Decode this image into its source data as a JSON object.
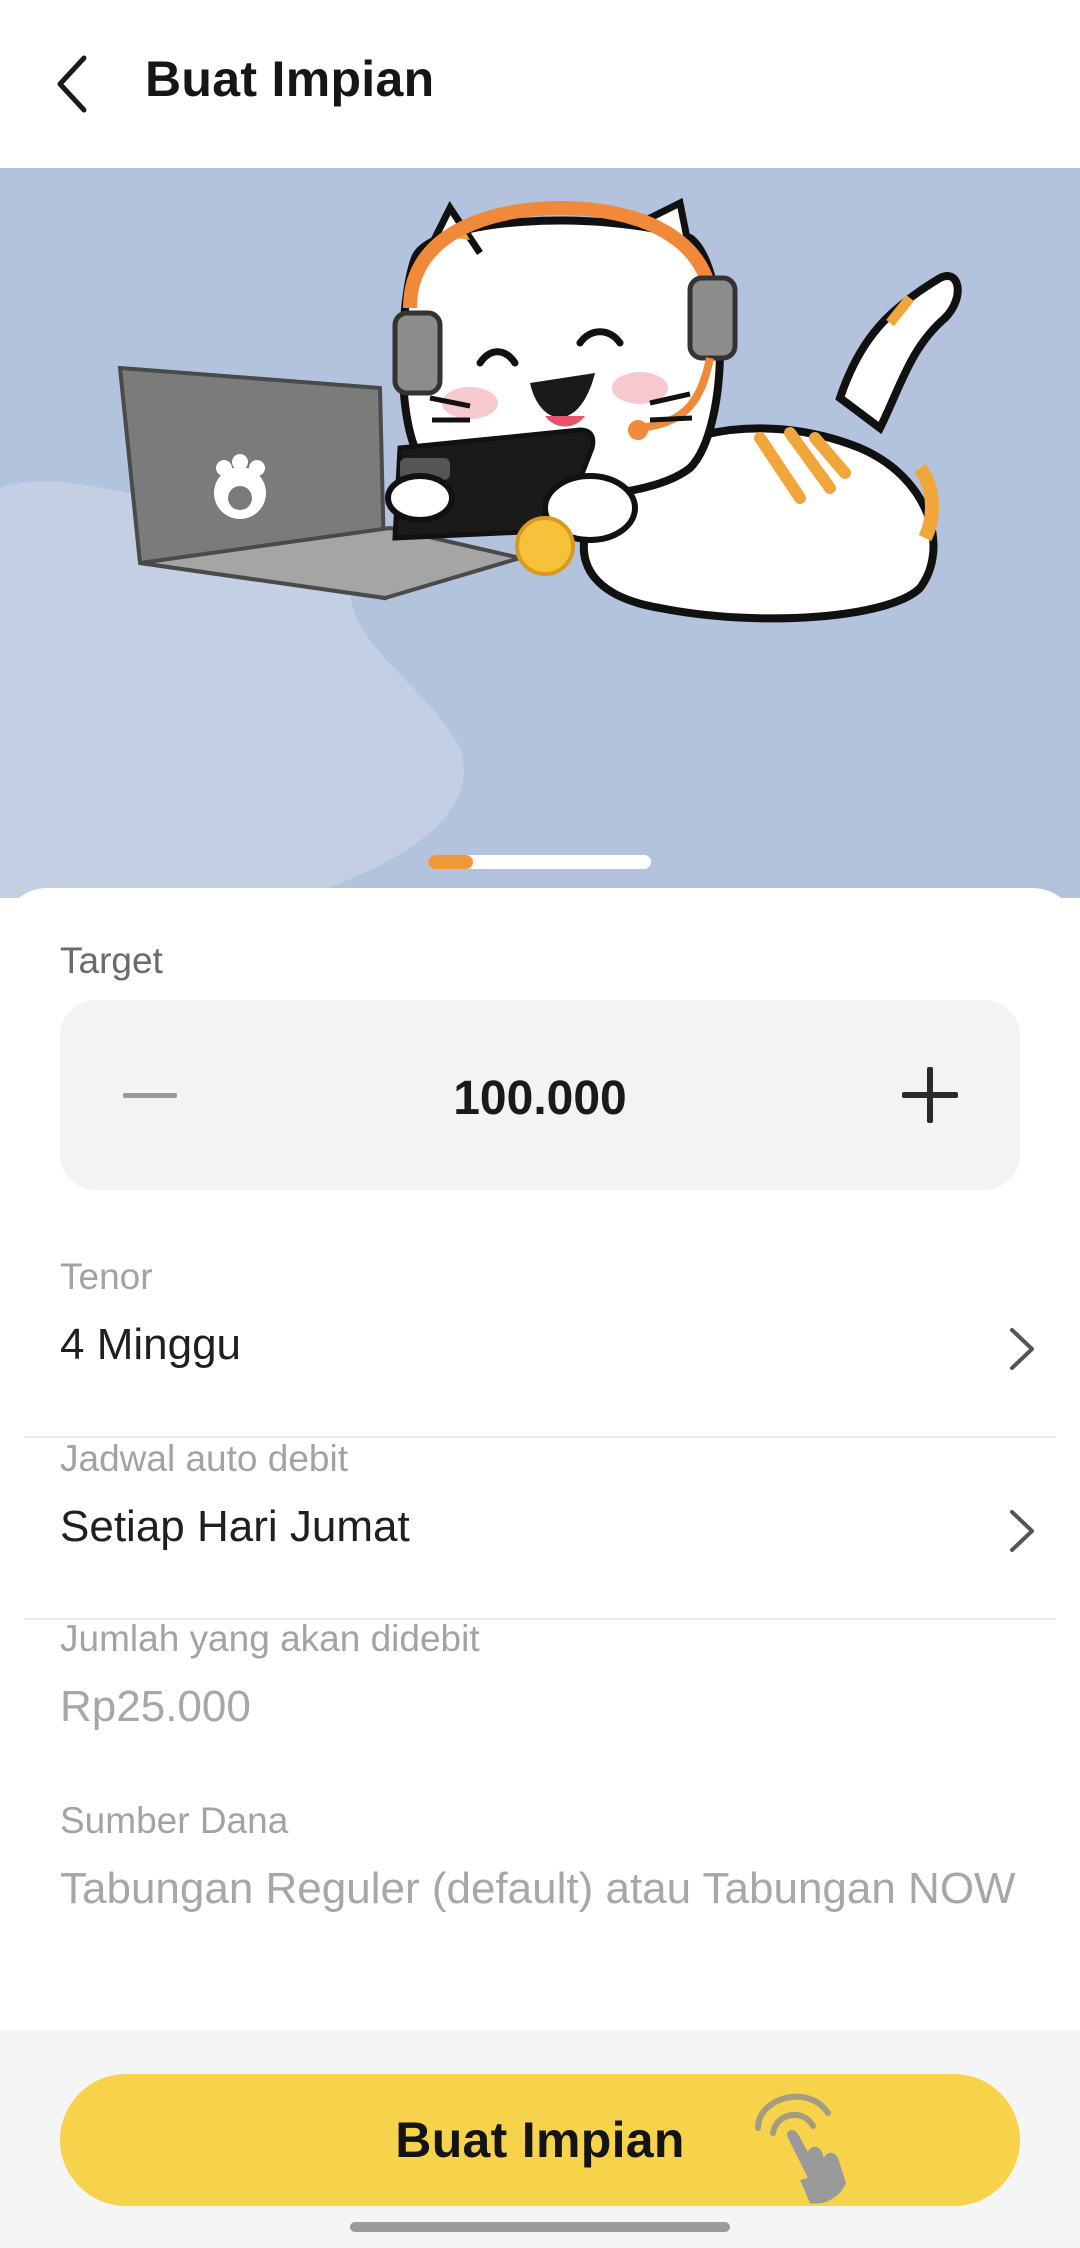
{
  "header": {
    "title": "Buat Impian",
    "back_icon": "chevron-left-icon"
  },
  "banner": {
    "illustration": "cat-with-headset-laptop-illustration",
    "background_color": "#b3c3dd",
    "pager": {
      "pages": 5,
      "active_index": 0,
      "active_color": "#ee9a38"
    }
  },
  "form": {
    "target": {
      "label": "Target",
      "value": "100.000",
      "decrement_icon": "minus-icon",
      "increment_icon": "plus-icon"
    },
    "tenor": {
      "label": "Tenor",
      "value": "4 Minggu"
    },
    "schedule": {
      "label": "Jadwal auto debit",
      "value": "Setiap Hari Jumat"
    },
    "debit_amount": {
      "label": "Jumlah yang akan didebit",
      "value": "Rp25.000"
    },
    "fund_source": {
      "label": "Sumber Dana",
      "value": "Tabungan Reguler (default) atau Tabungan NOW"
    }
  },
  "footer": {
    "button_label": "Buat Impian",
    "button_color": "#f6d34b",
    "tap_icon": "hand-tap-icon"
  }
}
